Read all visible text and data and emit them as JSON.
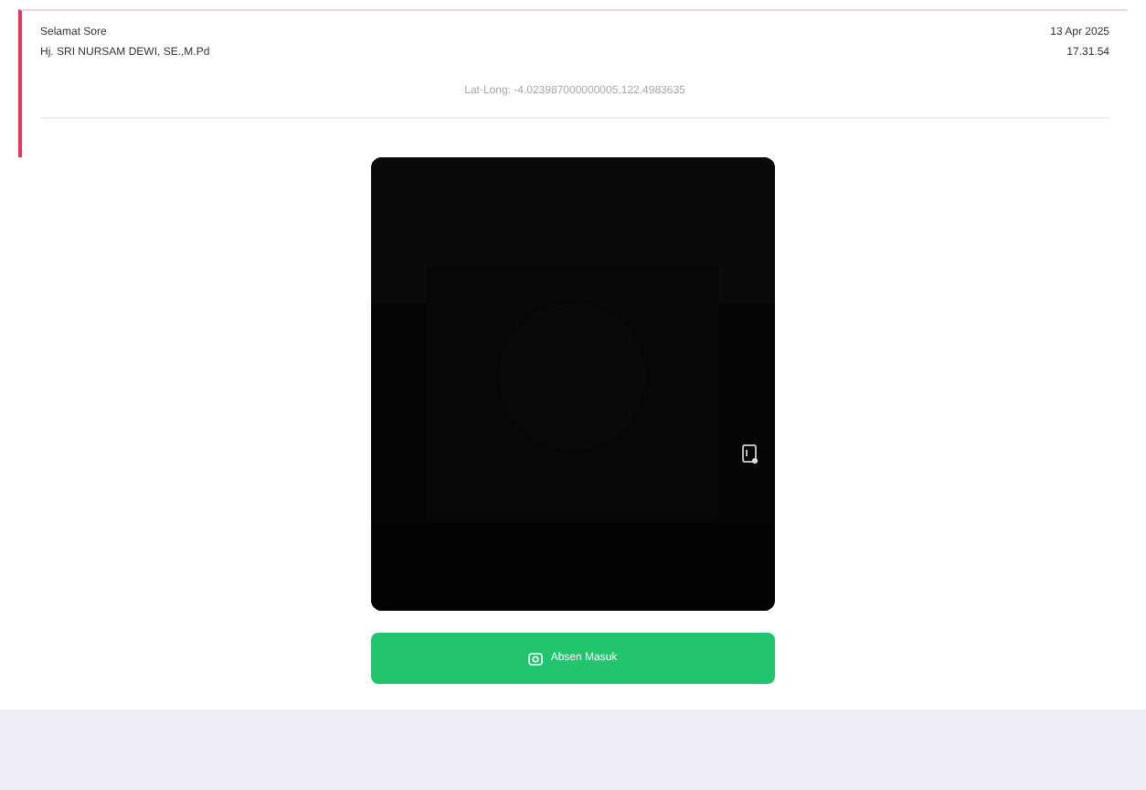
{
  "greeting": "Selamat Sore",
  "user_name": "Hj. SRI NURSAM DEWI, SE.,M.Pd",
  "date": "13 Apr 2025",
  "time": "17.31.54",
  "location": "Lat-Long: -4.023987000000005,122.4983635",
  "submit_button": {
    "label": "Absen Masuk"
  }
}
